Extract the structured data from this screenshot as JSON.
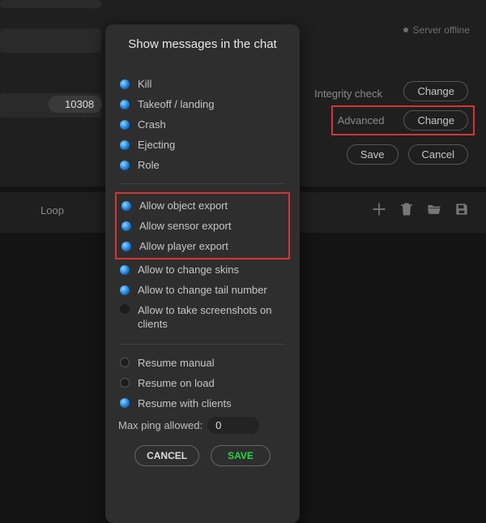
{
  "background": {
    "server_status": "Server offline",
    "port_value": "10308",
    "integrity_label": "Integrity check",
    "change_label": "Change",
    "advanced_label": "Advanced",
    "save_label": "Save",
    "cancel_label": "Cancel",
    "loop_label": "Loop"
  },
  "modal": {
    "title": "Show messages in the chat",
    "events": [
      {
        "label": "Kill",
        "checked": true
      },
      {
        "label": "Takeoff / landing",
        "checked": true
      },
      {
        "label": "Crash",
        "checked": true
      },
      {
        "label": "Ejecting",
        "checked": true
      },
      {
        "label": "Role",
        "checked": true
      }
    ],
    "exports": [
      {
        "label": "Allow object export",
        "checked": true
      },
      {
        "label": "Allow sensor export",
        "checked": true
      },
      {
        "label": "Allow player export",
        "checked": true
      }
    ],
    "other": [
      {
        "label": "Allow to change skins",
        "checked": true
      },
      {
        "label": "Allow to change tail number",
        "checked": true
      },
      {
        "label": "Allow to take screenshots on clients",
        "checked": false
      }
    ],
    "resume": [
      {
        "label": "Resume manual",
        "selected": false
      },
      {
        "label": "Resume on load",
        "selected": false
      },
      {
        "label": "Resume with clients",
        "selected": true
      }
    ],
    "ping_label": "Max ping allowed:",
    "ping_value": "0",
    "cancel_label": "CANCEL",
    "save_label": "SAVE"
  }
}
